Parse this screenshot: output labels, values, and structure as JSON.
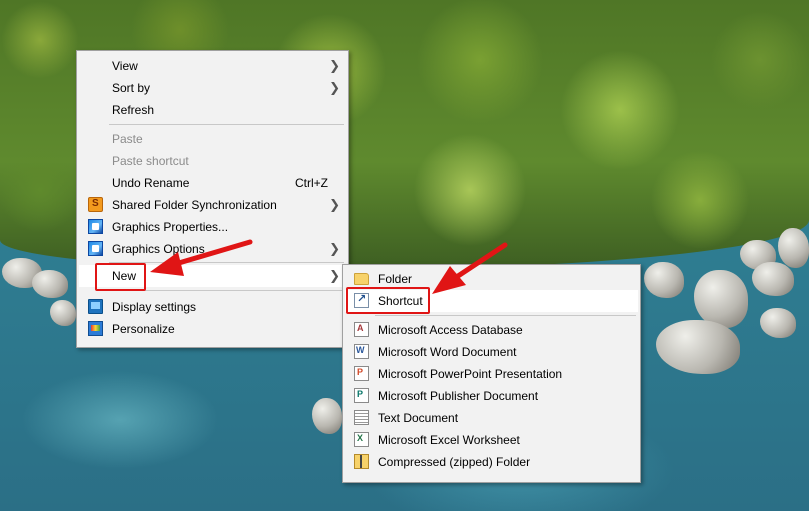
{
  "main_menu": {
    "items": [
      {
        "label": "View",
        "has_submenu": true
      },
      {
        "label": "Sort by",
        "has_submenu": true
      },
      {
        "label": "Refresh"
      },
      {
        "label": "Paste",
        "disabled": true
      },
      {
        "label": "Paste shortcut",
        "disabled": true
      },
      {
        "label": "Undo Rename",
        "shortcut": "Ctrl+Z"
      },
      {
        "label": "Shared Folder Synchronization",
        "has_submenu": true,
        "icon": "shared-folder-sync-icon"
      },
      {
        "label": "Graphics Properties...",
        "icon": "graphics-properties-icon"
      },
      {
        "label": "Graphics Options",
        "has_submenu": true,
        "icon": "graphics-options-icon"
      },
      {
        "label": "New",
        "has_submenu": true,
        "highlighted": true
      },
      {
        "label": "Display settings",
        "icon": "display-settings-icon"
      },
      {
        "label": "Personalize",
        "icon": "personalize-icon"
      }
    ],
    "submenu_arrow": "❯"
  },
  "new_submenu": {
    "items": [
      {
        "label": "Folder",
        "icon": "folder-icon"
      },
      {
        "label": "Shortcut",
        "icon": "shortcut-icon",
        "highlighted": true
      },
      {
        "label": "Microsoft Access Database",
        "icon": "access-icon"
      },
      {
        "label": "Microsoft Word Document",
        "icon": "word-icon"
      },
      {
        "label": "Microsoft PowerPoint Presentation",
        "icon": "powerpoint-icon"
      },
      {
        "label": "Microsoft Publisher Document",
        "icon": "publisher-icon"
      },
      {
        "label": "Text Document",
        "icon": "text-document-icon"
      },
      {
        "label": "Microsoft Excel Worksheet",
        "icon": "excel-icon"
      },
      {
        "label": "Compressed (zipped) Folder",
        "icon": "zip-folder-icon"
      }
    ]
  },
  "annotation": {
    "color": "#e01515"
  }
}
